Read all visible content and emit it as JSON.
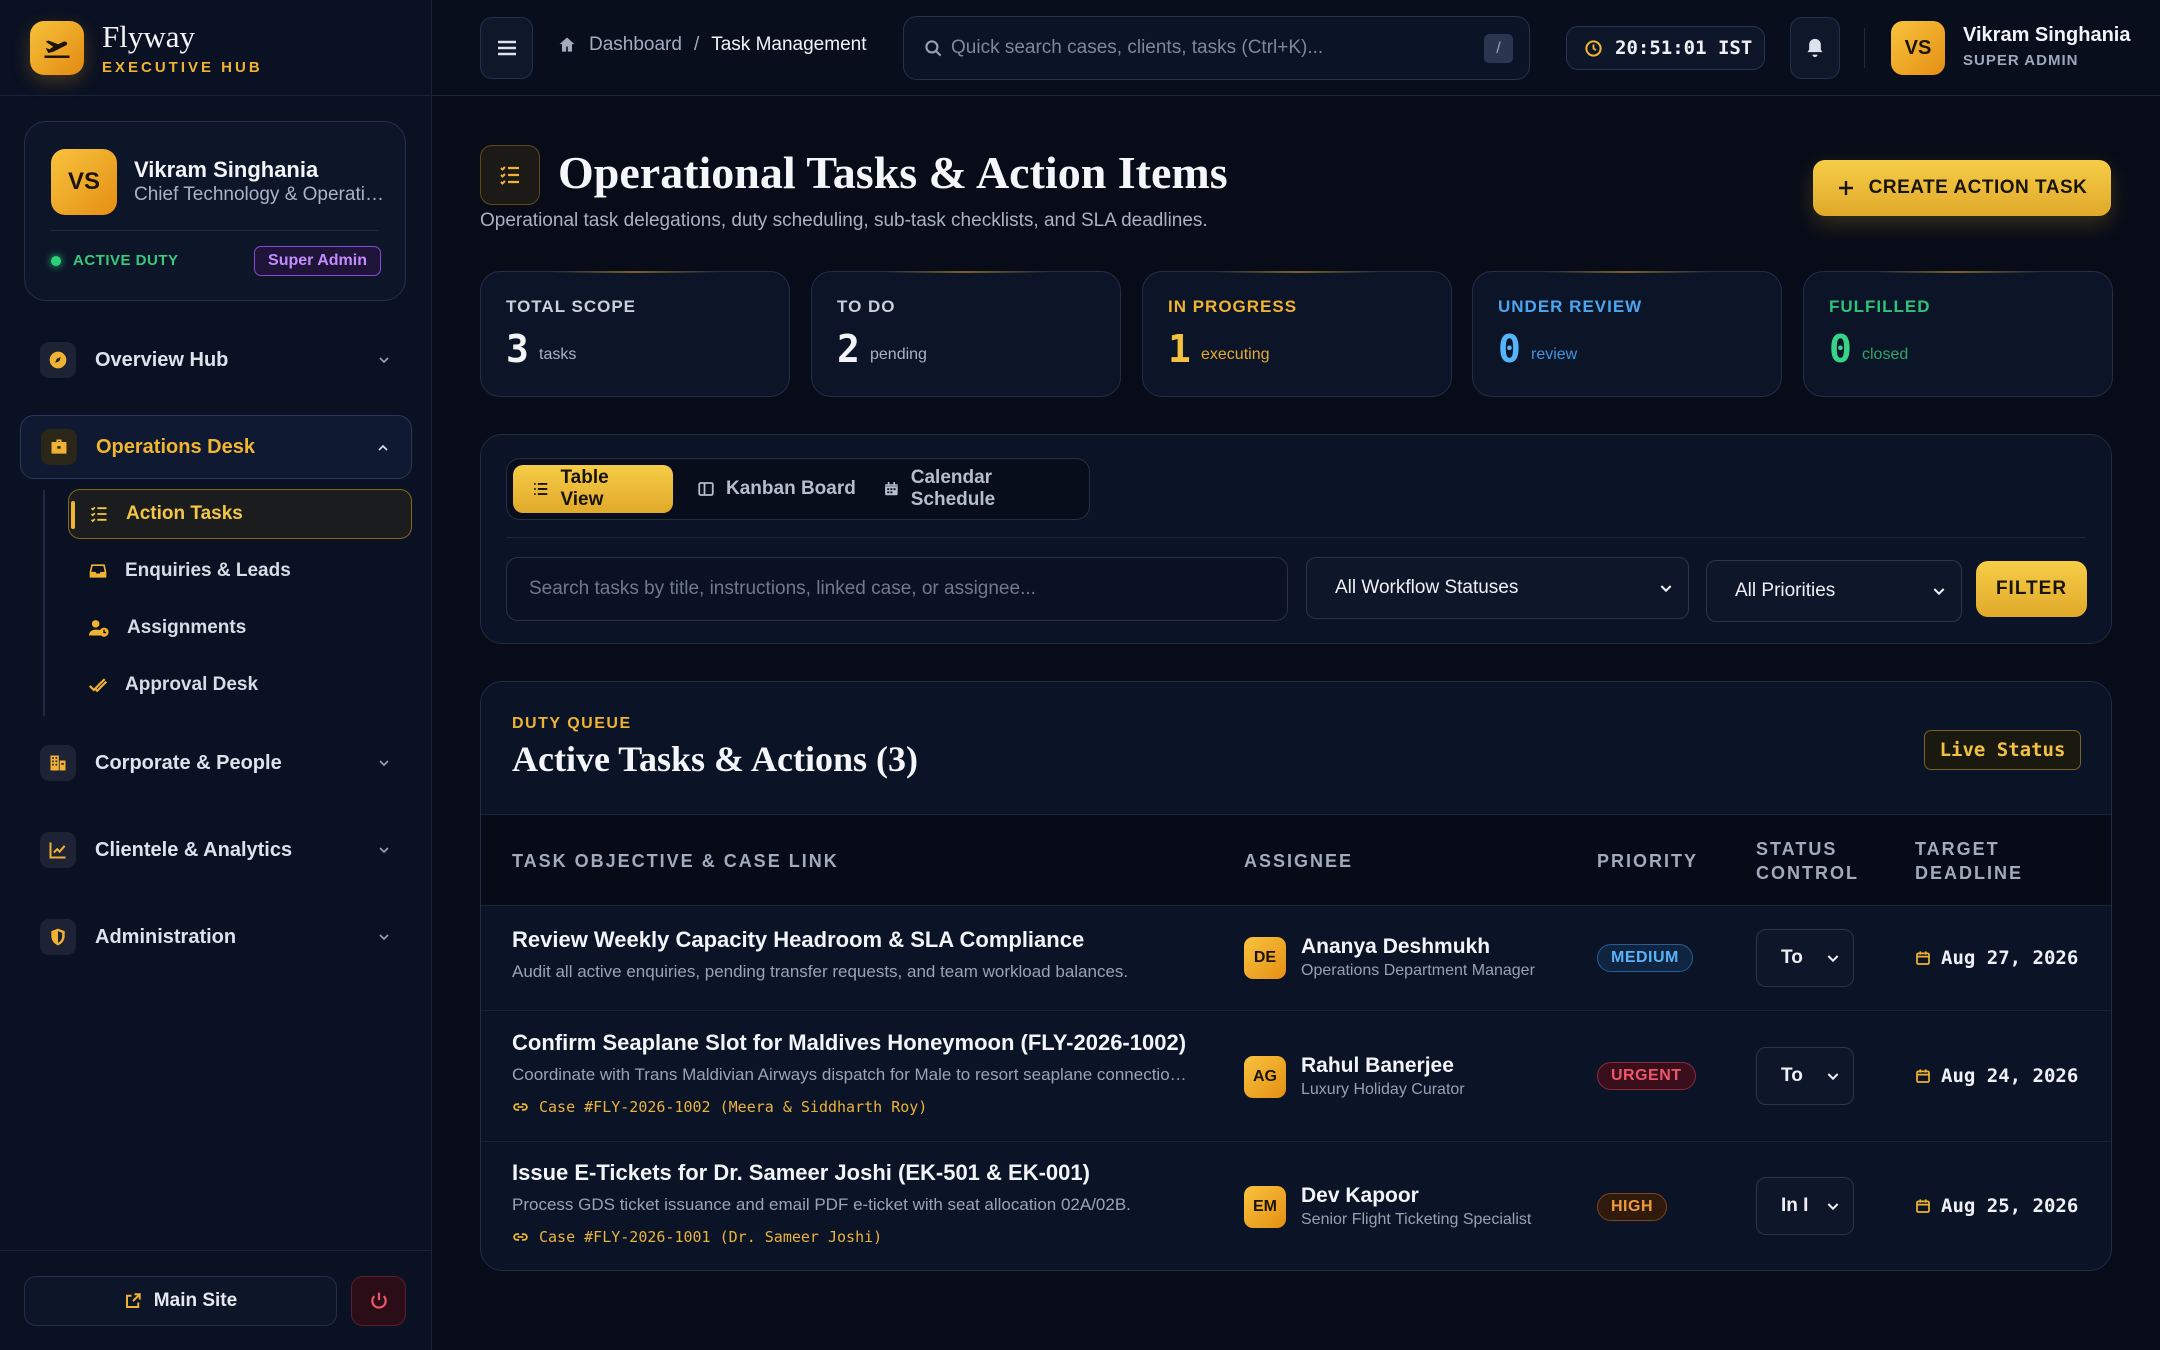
{
  "brand": {
    "name": "Flyway",
    "tagline": "EXECUTIVE HUB"
  },
  "profile": {
    "initials": "VS",
    "name": "Vikram Singhania",
    "role": "Chief Technology & Operations",
    "duty_status": "ACTIVE DUTY",
    "badge": "Super Admin"
  },
  "nav": {
    "overview": "Overview Hub",
    "operations": "Operations Desk",
    "sub": {
      "action_tasks": "Action Tasks",
      "enquiries": "Enquiries & Leads",
      "assignments": "Assignments",
      "approval": "Approval Desk"
    },
    "corporate": "Corporate & People",
    "clientele": "Clientele & Analytics",
    "administration": "Administration"
  },
  "footer": {
    "main_site": "Main Site"
  },
  "header": {
    "breadcrumb_home": "Dashboard",
    "breadcrumb_sep": "/",
    "breadcrumb_current": "Task Management",
    "search_placeholder": "Quick search cases, clients, tasks (Ctrl+K)...",
    "search_shortcut": "/",
    "clock": "20:51:01 IST",
    "user_initials": "VS",
    "user_name": "Vikram Singhania",
    "user_role": "SUPER ADMIN"
  },
  "page": {
    "title": "Operational Tasks & Action Items",
    "subtitle": "Operational task delegations, duty scheduling, sub-task checklists, and SLA deadlines.",
    "create_button": "CREATE ACTION TASK"
  },
  "stats": [
    {
      "label": "TOTAL SCOPE",
      "value": "3",
      "unit": "tasks",
      "color": "#c9cfdb",
      "value_color": "#f2f4f8",
      "unit_color": "#aab3c5"
    },
    {
      "label": "TO DO",
      "value": "2",
      "unit": "pending",
      "color": "#c9cfdb",
      "value_color": "#f2f4f8",
      "unit_color": "#aab3c5"
    },
    {
      "label": "IN PROGRESS",
      "value": "1",
      "unit": "executing",
      "color": "#f0b232",
      "value_color": "#f3c13c",
      "unit_color": "#e3a935"
    },
    {
      "label": "UNDER REVIEW",
      "value": "0",
      "unit": "review",
      "color": "#4aa6f0",
      "value_color": "#56b4fa",
      "unit_color": "#3f95de"
    },
    {
      "label": "FULFILLED",
      "value": "0",
      "unit": "closed",
      "color": "#2fc27a",
      "value_color": "#35d487",
      "unit_color": "#2aa868"
    }
  ],
  "views": {
    "table": "Table View",
    "kanban": "Kanban Board",
    "calendar": "Calendar Schedule"
  },
  "filters": {
    "search_placeholder": "Search tasks by title, instructions, linked case, or assignee...",
    "status": "All Workflow Statuses",
    "priority": "All Priorities",
    "button": "FILTER"
  },
  "queue": {
    "label": "DUTY QUEUE",
    "title": "Active Tasks & Actions (3)",
    "live": "Live Status",
    "columns": {
      "objective": "TASK OBJECTIVE & CASE LINK",
      "assignee": "ASSIGNEE",
      "priority": "PRIORITY",
      "status_1": "STATUS",
      "status_2": "CONTROL",
      "deadline_1": "TARGET",
      "deadline_2": "DEADLINE"
    },
    "rows": [
      {
        "title": "Review Weekly Capacity Headroom & SLA Compliance",
        "desc": "Audit all active enquiries, pending transfer requests, and team workload balances.",
        "link": "",
        "initials": "DE",
        "assignee": "Ananya Deshmukh",
        "assignee_role": "Operations Department Manager",
        "priority": "MEDIUM",
        "status": "To",
        "deadline": "Aug 27, 2026"
      },
      {
        "title": "Confirm Seaplane Slot for Maldives Honeymoon (FLY-2026-1002)",
        "desc": "Coordinate with Trans Maldivian Airways dispatch for Male to resort seaplane connection and luggage transfer.",
        "link": "Case #FLY-2026-1002 (Meera & Siddharth Roy)",
        "initials": "AG",
        "assignee": "Rahul Banerjee",
        "assignee_role": "Luxury Holiday Curator",
        "priority": "URGENT",
        "status": "To",
        "deadline": "Aug 24, 2026"
      },
      {
        "title": "Issue E-Tickets for Dr. Sameer Joshi (EK-501 & EK-001)",
        "desc": "Process GDS ticket issuance and email PDF e-ticket with seat allocation 02A/02B.",
        "link": "Case #FLY-2026-1001 (Dr. Sameer Joshi)",
        "initials": "EM",
        "assignee": "Dev Kapoor",
        "assignee_role": "Senior Flight Ticketing Specialist",
        "priority": "HIGH",
        "status": "In I",
        "deadline": "Aug 25, 2026"
      }
    ]
  },
  "colors": {
    "accent": "#f0b232",
    "priority_medium": "#4aa6f0",
    "priority_urgent": "#f0556a",
    "priority_high": "#f29a3a"
  }
}
